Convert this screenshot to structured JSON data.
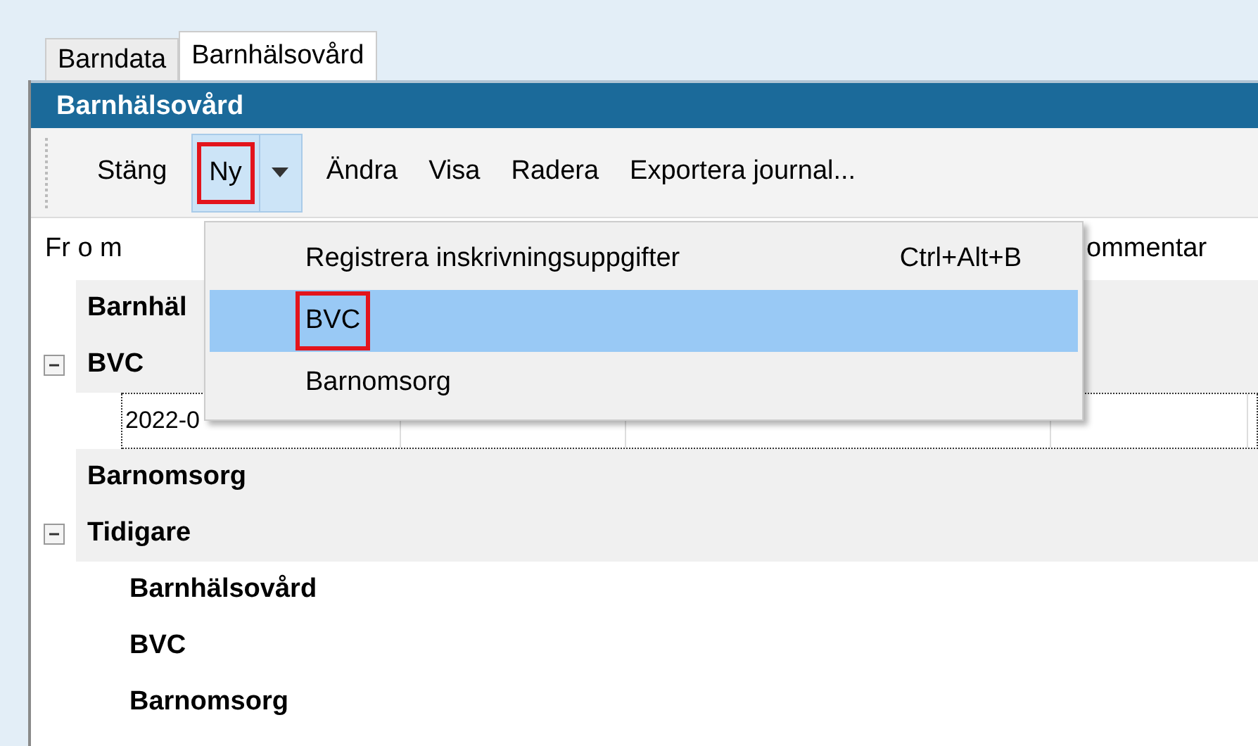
{
  "tabs": [
    {
      "label": "Barndata",
      "selected": false
    },
    {
      "label": "Barnhälsovård",
      "selected": true
    }
  ],
  "panel_title": "Barnhälsovård",
  "toolbar": [
    {
      "label": "Stäng",
      "kind": "button",
      "pressed": false,
      "highlighted": false
    },
    {
      "label": "Ny",
      "kind": "split",
      "pressed": true,
      "highlighted": true
    },
    {
      "label": "Ändra",
      "kind": "button",
      "pressed": false,
      "highlighted": false
    },
    {
      "label": "Visa",
      "kind": "button",
      "pressed": false,
      "highlighted": false
    },
    {
      "label": "Radera",
      "kind": "button",
      "pressed": false,
      "highlighted": false
    },
    {
      "label": "Exportera journal...",
      "kind": "button",
      "pressed": false,
      "highlighted": false
    }
  ],
  "columns": [
    "Fr o m",
    "ommentar"
  ],
  "tree": [
    {
      "label": "Barnhäl",
      "kind": "group"
    },
    {
      "label": "BVC",
      "kind": "group",
      "expanded": true,
      "children": [
        {
          "kind": "row",
          "focused": true,
          "cells": [
            "2022-0"
          ]
        }
      ]
    },
    {
      "label": "Barnomsorg",
      "kind": "group"
    },
    {
      "label": "Tidigare",
      "kind": "group",
      "expanded": true,
      "children": [
        {
          "label": "Barnhälsovård",
          "kind": "item"
        },
        {
          "label": "BVC",
          "kind": "item"
        },
        {
          "label": "Barnomsorg",
          "kind": "item"
        }
      ]
    }
  ],
  "menu": {
    "items": [
      {
        "label": "Registrera inskrivningsuppgifter",
        "shortcut": "Ctrl+Alt+B",
        "selected": false,
        "highlighted": false
      },
      {
        "label": "BVC",
        "selected": true,
        "highlighted": true
      },
      {
        "label": "Barnomsorg",
        "selected": false,
        "highlighted": false
      }
    ]
  }
}
